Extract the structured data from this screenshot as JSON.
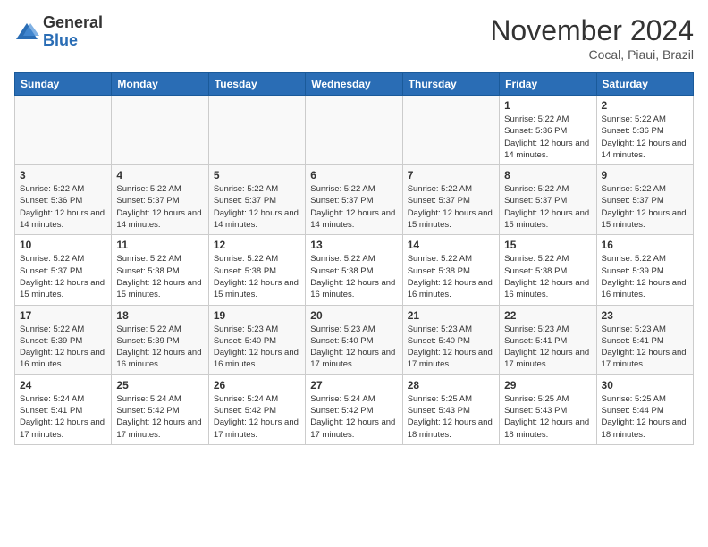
{
  "header": {
    "logo_general": "General",
    "logo_blue": "Blue",
    "title": "November 2024",
    "location": "Cocal, Piaui, Brazil"
  },
  "days_of_week": [
    "Sunday",
    "Monday",
    "Tuesday",
    "Wednesday",
    "Thursday",
    "Friday",
    "Saturday"
  ],
  "weeks": [
    [
      {
        "day": "",
        "info": ""
      },
      {
        "day": "",
        "info": ""
      },
      {
        "day": "",
        "info": ""
      },
      {
        "day": "",
        "info": ""
      },
      {
        "day": "",
        "info": ""
      },
      {
        "day": "1",
        "info": "Sunrise: 5:22 AM\nSunset: 5:36 PM\nDaylight: 12 hours and 14 minutes."
      },
      {
        "day": "2",
        "info": "Sunrise: 5:22 AM\nSunset: 5:36 PM\nDaylight: 12 hours and 14 minutes."
      }
    ],
    [
      {
        "day": "3",
        "info": "Sunrise: 5:22 AM\nSunset: 5:36 PM\nDaylight: 12 hours and 14 minutes."
      },
      {
        "day": "4",
        "info": "Sunrise: 5:22 AM\nSunset: 5:37 PM\nDaylight: 12 hours and 14 minutes."
      },
      {
        "day": "5",
        "info": "Sunrise: 5:22 AM\nSunset: 5:37 PM\nDaylight: 12 hours and 14 minutes."
      },
      {
        "day": "6",
        "info": "Sunrise: 5:22 AM\nSunset: 5:37 PM\nDaylight: 12 hours and 14 minutes."
      },
      {
        "day": "7",
        "info": "Sunrise: 5:22 AM\nSunset: 5:37 PM\nDaylight: 12 hours and 15 minutes."
      },
      {
        "day": "8",
        "info": "Sunrise: 5:22 AM\nSunset: 5:37 PM\nDaylight: 12 hours and 15 minutes."
      },
      {
        "day": "9",
        "info": "Sunrise: 5:22 AM\nSunset: 5:37 PM\nDaylight: 12 hours and 15 minutes."
      }
    ],
    [
      {
        "day": "10",
        "info": "Sunrise: 5:22 AM\nSunset: 5:37 PM\nDaylight: 12 hours and 15 minutes."
      },
      {
        "day": "11",
        "info": "Sunrise: 5:22 AM\nSunset: 5:38 PM\nDaylight: 12 hours and 15 minutes."
      },
      {
        "day": "12",
        "info": "Sunrise: 5:22 AM\nSunset: 5:38 PM\nDaylight: 12 hours and 15 minutes."
      },
      {
        "day": "13",
        "info": "Sunrise: 5:22 AM\nSunset: 5:38 PM\nDaylight: 12 hours and 16 minutes."
      },
      {
        "day": "14",
        "info": "Sunrise: 5:22 AM\nSunset: 5:38 PM\nDaylight: 12 hours and 16 minutes."
      },
      {
        "day": "15",
        "info": "Sunrise: 5:22 AM\nSunset: 5:38 PM\nDaylight: 12 hours and 16 minutes."
      },
      {
        "day": "16",
        "info": "Sunrise: 5:22 AM\nSunset: 5:39 PM\nDaylight: 12 hours and 16 minutes."
      }
    ],
    [
      {
        "day": "17",
        "info": "Sunrise: 5:22 AM\nSunset: 5:39 PM\nDaylight: 12 hours and 16 minutes."
      },
      {
        "day": "18",
        "info": "Sunrise: 5:22 AM\nSunset: 5:39 PM\nDaylight: 12 hours and 16 minutes."
      },
      {
        "day": "19",
        "info": "Sunrise: 5:23 AM\nSunset: 5:40 PM\nDaylight: 12 hours and 16 minutes."
      },
      {
        "day": "20",
        "info": "Sunrise: 5:23 AM\nSunset: 5:40 PM\nDaylight: 12 hours and 17 minutes."
      },
      {
        "day": "21",
        "info": "Sunrise: 5:23 AM\nSunset: 5:40 PM\nDaylight: 12 hours and 17 minutes."
      },
      {
        "day": "22",
        "info": "Sunrise: 5:23 AM\nSunset: 5:41 PM\nDaylight: 12 hours and 17 minutes."
      },
      {
        "day": "23",
        "info": "Sunrise: 5:23 AM\nSunset: 5:41 PM\nDaylight: 12 hours and 17 minutes."
      }
    ],
    [
      {
        "day": "24",
        "info": "Sunrise: 5:24 AM\nSunset: 5:41 PM\nDaylight: 12 hours and 17 minutes."
      },
      {
        "day": "25",
        "info": "Sunrise: 5:24 AM\nSunset: 5:42 PM\nDaylight: 12 hours and 17 minutes."
      },
      {
        "day": "26",
        "info": "Sunrise: 5:24 AM\nSunset: 5:42 PM\nDaylight: 12 hours and 17 minutes."
      },
      {
        "day": "27",
        "info": "Sunrise: 5:24 AM\nSunset: 5:42 PM\nDaylight: 12 hours and 17 minutes."
      },
      {
        "day": "28",
        "info": "Sunrise: 5:25 AM\nSunset: 5:43 PM\nDaylight: 12 hours and 18 minutes."
      },
      {
        "day": "29",
        "info": "Sunrise: 5:25 AM\nSunset: 5:43 PM\nDaylight: 12 hours and 18 minutes."
      },
      {
        "day": "30",
        "info": "Sunrise: 5:25 AM\nSunset: 5:44 PM\nDaylight: 12 hours and 18 minutes."
      }
    ]
  ]
}
